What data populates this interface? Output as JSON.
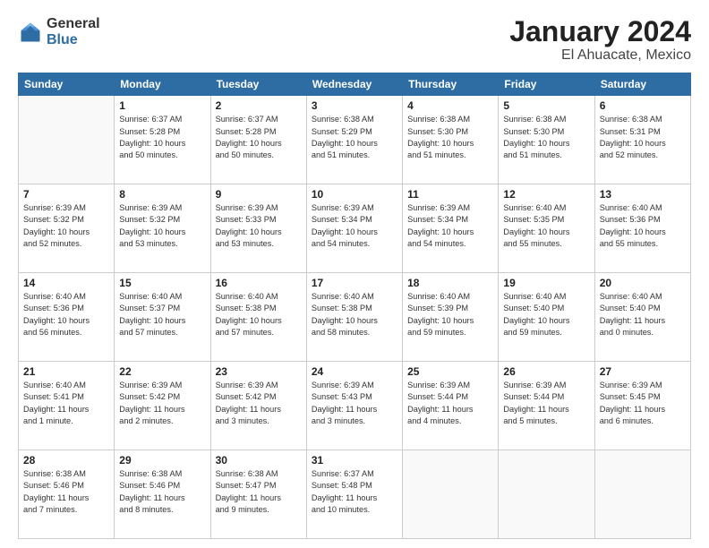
{
  "header": {
    "logo_general": "General",
    "logo_blue": "Blue",
    "title": "January 2024",
    "subtitle": "El Ahuacate, Mexico"
  },
  "weekdays": [
    "Sunday",
    "Monday",
    "Tuesday",
    "Wednesday",
    "Thursday",
    "Friday",
    "Saturday"
  ],
  "weeks": [
    [
      {
        "day": "",
        "info": ""
      },
      {
        "day": "1",
        "info": "Sunrise: 6:37 AM\nSunset: 5:28 PM\nDaylight: 10 hours\nand 50 minutes."
      },
      {
        "day": "2",
        "info": "Sunrise: 6:37 AM\nSunset: 5:28 PM\nDaylight: 10 hours\nand 50 minutes."
      },
      {
        "day": "3",
        "info": "Sunrise: 6:38 AM\nSunset: 5:29 PM\nDaylight: 10 hours\nand 51 minutes."
      },
      {
        "day": "4",
        "info": "Sunrise: 6:38 AM\nSunset: 5:30 PM\nDaylight: 10 hours\nand 51 minutes."
      },
      {
        "day": "5",
        "info": "Sunrise: 6:38 AM\nSunset: 5:30 PM\nDaylight: 10 hours\nand 51 minutes."
      },
      {
        "day": "6",
        "info": "Sunrise: 6:38 AM\nSunset: 5:31 PM\nDaylight: 10 hours\nand 52 minutes."
      }
    ],
    [
      {
        "day": "7",
        "info": "Sunrise: 6:39 AM\nSunset: 5:32 PM\nDaylight: 10 hours\nand 52 minutes."
      },
      {
        "day": "8",
        "info": "Sunrise: 6:39 AM\nSunset: 5:32 PM\nDaylight: 10 hours\nand 53 minutes."
      },
      {
        "day": "9",
        "info": "Sunrise: 6:39 AM\nSunset: 5:33 PM\nDaylight: 10 hours\nand 53 minutes."
      },
      {
        "day": "10",
        "info": "Sunrise: 6:39 AM\nSunset: 5:34 PM\nDaylight: 10 hours\nand 54 minutes."
      },
      {
        "day": "11",
        "info": "Sunrise: 6:39 AM\nSunset: 5:34 PM\nDaylight: 10 hours\nand 54 minutes."
      },
      {
        "day": "12",
        "info": "Sunrise: 6:40 AM\nSunset: 5:35 PM\nDaylight: 10 hours\nand 55 minutes."
      },
      {
        "day": "13",
        "info": "Sunrise: 6:40 AM\nSunset: 5:36 PM\nDaylight: 10 hours\nand 55 minutes."
      }
    ],
    [
      {
        "day": "14",
        "info": "Sunrise: 6:40 AM\nSunset: 5:36 PM\nDaylight: 10 hours\nand 56 minutes."
      },
      {
        "day": "15",
        "info": "Sunrise: 6:40 AM\nSunset: 5:37 PM\nDaylight: 10 hours\nand 57 minutes."
      },
      {
        "day": "16",
        "info": "Sunrise: 6:40 AM\nSunset: 5:38 PM\nDaylight: 10 hours\nand 57 minutes."
      },
      {
        "day": "17",
        "info": "Sunrise: 6:40 AM\nSunset: 5:38 PM\nDaylight: 10 hours\nand 58 minutes."
      },
      {
        "day": "18",
        "info": "Sunrise: 6:40 AM\nSunset: 5:39 PM\nDaylight: 10 hours\nand 59 minutes."
      },
      {
        "day": "19",
        "info": "Sunrise: 6:40 AM\nSunset: 5:40 PM\nDaylight: 10 hours\nand 59 minutes."
      },
      {
        "day": "20",
        "info": "Sunrise: 6:40 AM\nSunset: 5:40 PM\nDaylight: 11 hours\nand 0 minutes."
      }
    ],
    [
      {
        "day": "21",
        "info": "Sunrise: 6:40 AM\nSunset: 5:41 PM\nDaylight: 11 hours\nand 1 minute."
      },
      {
        "day": "22",
        "info": "Sunrise: 6:39 AM\nSunset: 5:42 PM\nDaylight: 11 hours\nand 2 minutes."
      },
      {
        "day": "23",
        "info": "Sunrise: 6:39 AM\nSunset: 5:42 PM\nDaylight: 11 hours\nand 3 minutes."
      },
      {
        "day": "24",
        "info": "Sunrise: 6:39 AM\nSunset: 5:43 PM\nDaylight: 11 hours\nand 3 minutes."
      },
      {
        "day": "25",
        "info": "Sunrise: 6:39 AM\nSunset: 5:44 PM\nDaylight: 11 hours\nand 4 minutes."
      },
      {
        "day": "26",
        "info": "Sunrise: 6:39 AM\nSunset: 5:44 PM\nDaylight: 11 hours\nand 5 minutes."
      },
      {
        "day": "27",
        "info": "Sunrise: 6:39 AM\nSunset: 5:45 PM\nDaylight: 11 hours\nand 6 minutes."
      }
    ],
    [
      {
        "day": "28",
        "info": "Sunrise: 6:38 AM\nSunset: 5:46 PM\nDaylight: 11 hours\nand 7 minutes."
      },
      {
        "day": "29",
        "info": "Sunrise: 6:38 AM\nSunset: 5:46 PM\nDaylight: 11 hours\nand 8 minutes."
      },
      {
        "day": "30",
        "info": "Sunrise: 6:38 AM\nSunset: 5:47 PM\nDaylight: 11 hours\nand 9 minutes."
      },
      {
        "day": "31",
        "info": "Sunrise: 6:37 AM\nSunset: 5:48 PM\nDaylight: 11 hours\nand 10 minutes."
      },
      {
        "day": "",
        "info": ""
      },
      {
        "day": "",
        "info": ""
      },
      {
        "day": "",
        "info": ""
      }
    ]
  ]
}
